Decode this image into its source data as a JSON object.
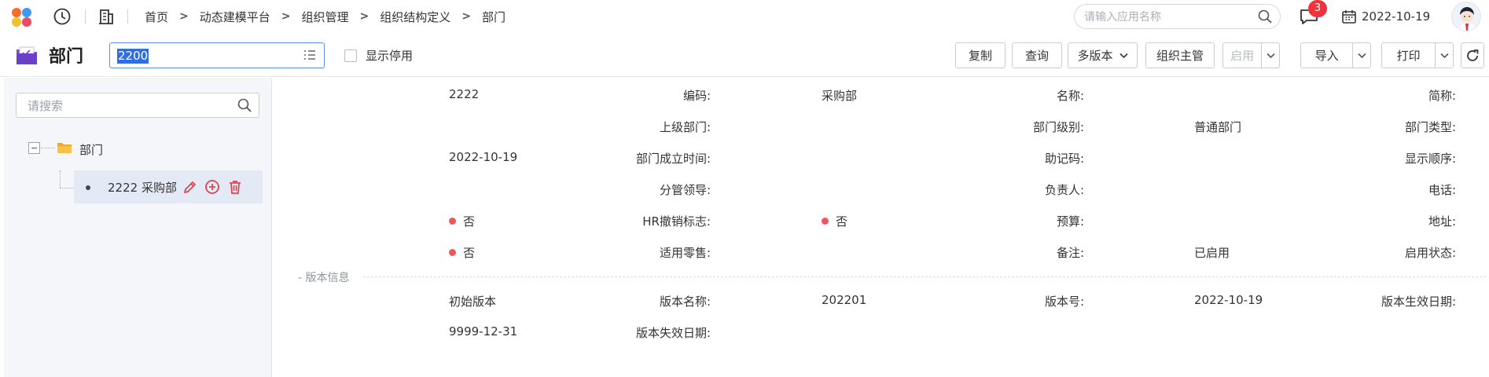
{
  "breadcrumbs": [
    "首页",
    "动态建模平台",
    "组织管理",
    "组织结构定义",
    "部门"
  ],
  "search": {
    "placeholder": "请输入应用名称"
  },
  "notifications": {
    "count": "3"
  },
  "header": {
    "date": "2022-10-19"
  },
  "toolbar": {
    "title": "部门",
    "code_value": "2200",
    "show_disabled_label": "显示停用",
    "buttons": {
      "copy": "复制",
      "query": "查询",
      "multi_version": "多版本",
      "org_manager": "组织主管",
      "enable": "启用",
      "import": "导入",
      "print": "打印"
    }
  },
  "tree": {
    "search_placeholder": "请搜索",
    "root_label": "部门",
    "child_label": "2222 采购部"
  },
  "form": {
    "code": {
      "label": "编码:",
      "value": "2222"
    },
    "name": {
      "label": "名称:",
      "value": "采购部"
    },
    "short_name": {
      "label": "简称:",
      "value": ""
    },
    "parent_dept": {
      "label": "上级部门:",
      "value": ""
    },
    "dept_level": {
      "label": "部门级别:",
      "value": ""
    },
    "dept_type": {
      "label": "部门类型:",
      "value": "普通部门"
    },
    "established": {
      "label": "部门成立时间:",
      "value": "2022-10-19"
    },
    "mnemonic": {
      "label": "助记码:",
      "value": ""
    },
    "display_order": {
      "label": "显示顺序:",
      "value": ""
    },
    "leader": {
      "label": "分管领导:",
      "value": ""
    },
    "owner": {
      "label": "负责人:",
      "value": ""
    },
    "phone": {
      "label": "电话:",
      "value": ""
    },
    "hr_revoke": {
      "label": "HR撤销标志:",
      "value": "否"
    },
    "budget": {
      "label": "预算:",
      "value": "否"
    },
    "address": {
      "label": "地址:",
      "value": ""
    },
    "retail": {
      "label": "适用零售:",
      "value": "否"
    },
    "remark": {
      "label": "备注:",
      "value": ""
    },
    "status": {
      "label": "启用状态:",
      "value": "已启用"
    }
  },
  "version_section": {
    "title": "- 版本信息",
    "name": {
      "label": "版本名称:",
      "value": "初始版本"
    },
    "number": {
      "label": "版本号:",
      "value": "202201"
    },
    "effective": {
      "label": "版本生效日期:",
      "value": "2022-10-19"
    },
    "expiry": {
      "label": "版本失效日期:",
      "value": "9999-12-31"
    }
  },
  "colors": {
    "primary": "#2f6fe0",
    "badge": "#f0323c",
    "danger_icon": "#e0454f",
    "status_dot": "#f0555e"
  }
}
